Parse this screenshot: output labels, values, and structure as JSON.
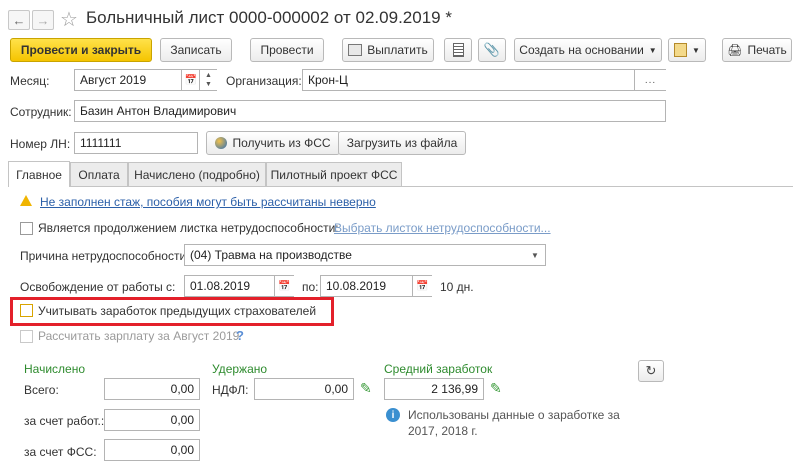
{
  "window": {
    "title": "Больничный лист 0000-000002 от 02.09.2019 *"
  },
  "toolbar": {
    "post_close": "Провести и закрыть",
    "save": "Записать",
    "post": "Провести",
    "pay": "Выплатить",
    "create_based": "Создать на основании",
    "print": "Печать"
  },
  "header": {
    "month_label": "Месяц:",
    "month_value": "Август 2019",
    "org_label": "Организация:",
    "org_value": "Крон-Ц",
    "employee_label": "Сотрудник:",
    "employee_value": "Базин Антон Владимирович",
    "ln_label": "Номер ЛН:",
    "ln_value": "1111111",
    "get_fss": "Получить из ФСС",
    "load_file": "Загрузить из файла"
  },
  "tabs": [
    "Главное",
    "Оплата",
    "Начислено (подробно)",
    "Пилотный проект ФСС"
  ],
  "main": {
    "warning_link": "Не заполнен стаж, пособия могут быть рассчитаны неверно",
    "continuation_label": "Является продолжением листка нетрудоспособности:",
    "continuation_link": "Выбрать листок нетрудоспособности...",
    "reason_label": "Причина нетрудоспособности:",
    "reason_value": "(04) Травма на производстве",
    "release_label": "Освобождение от работы с:",
    "date_from": "01.08.2019",
    "to_label": "по:",
    "date_to": "10.08.2019",
    "days": "10 дн.",
    "prev_insurers_label": "Учитывать заработок предыдущих страхователей",
    "calc_salary_label": "Рассчитать зарплату за Август 2019",
    "help": "?"
  },
  "amounts": {
    "accrued_title": "Начислено",
    "total_label": "Всего:",
    "total_value": "0,00",
    "employer_label": "за счет работ.:",
    "employer_value": "0,00",
    "fss_label": "за счет ФСС:",
    "fss_value": "0,00",
    "withheld_title": "Удержано",
    "ndfl_label": "НДФЛ:",
    "ndfl_value": "0,00",
    "avg_title": "Средний заработок",
    "avg_value": "2 136,99",
    "info_text_1": "Использованы данные о заработке за",
    "info_text_2": "2017,  2018 г."
  },
  "colors": {
    "primary": "#f5c400",
    "highlight_frame": "#e3202a",
    "link": "#2b5fa8",
    "section_green": "#2e8b2e"
  }
}
